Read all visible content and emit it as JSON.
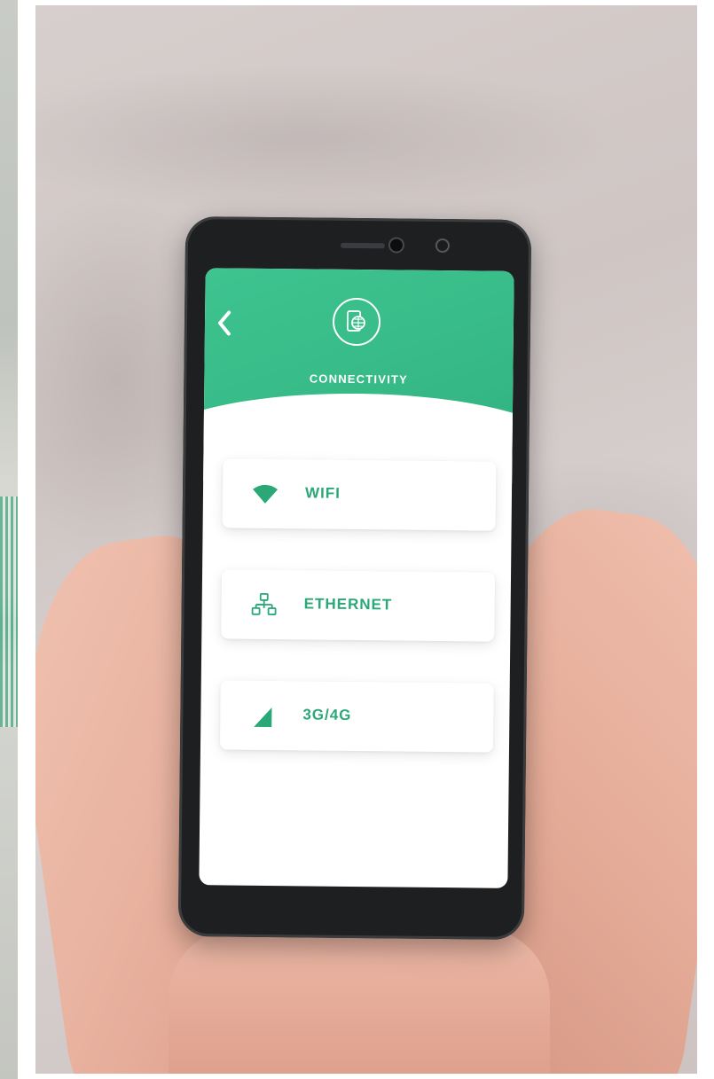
{
  "screen": {
    "header": {
      "title": "CONNECTIVITY",
      "back_icon": "chevron-left-icon",
      "badge_icon": "phone-globe-icon"
    },
    "options": [
      {
        "label": "WIFI",
        "icon": "wifi-icon"
      },
      {
        "label": "ETHERNET",
        "icon": "network-icon"
      },
      {
        "label": "3G/4G",
        "icon": "cellular-signal-icon"
      }
    ]
  },
  "colors": {
    "accent": "#33b583",
    "label": "#2aa877",
    "background": "#ffffff"
  }
}
